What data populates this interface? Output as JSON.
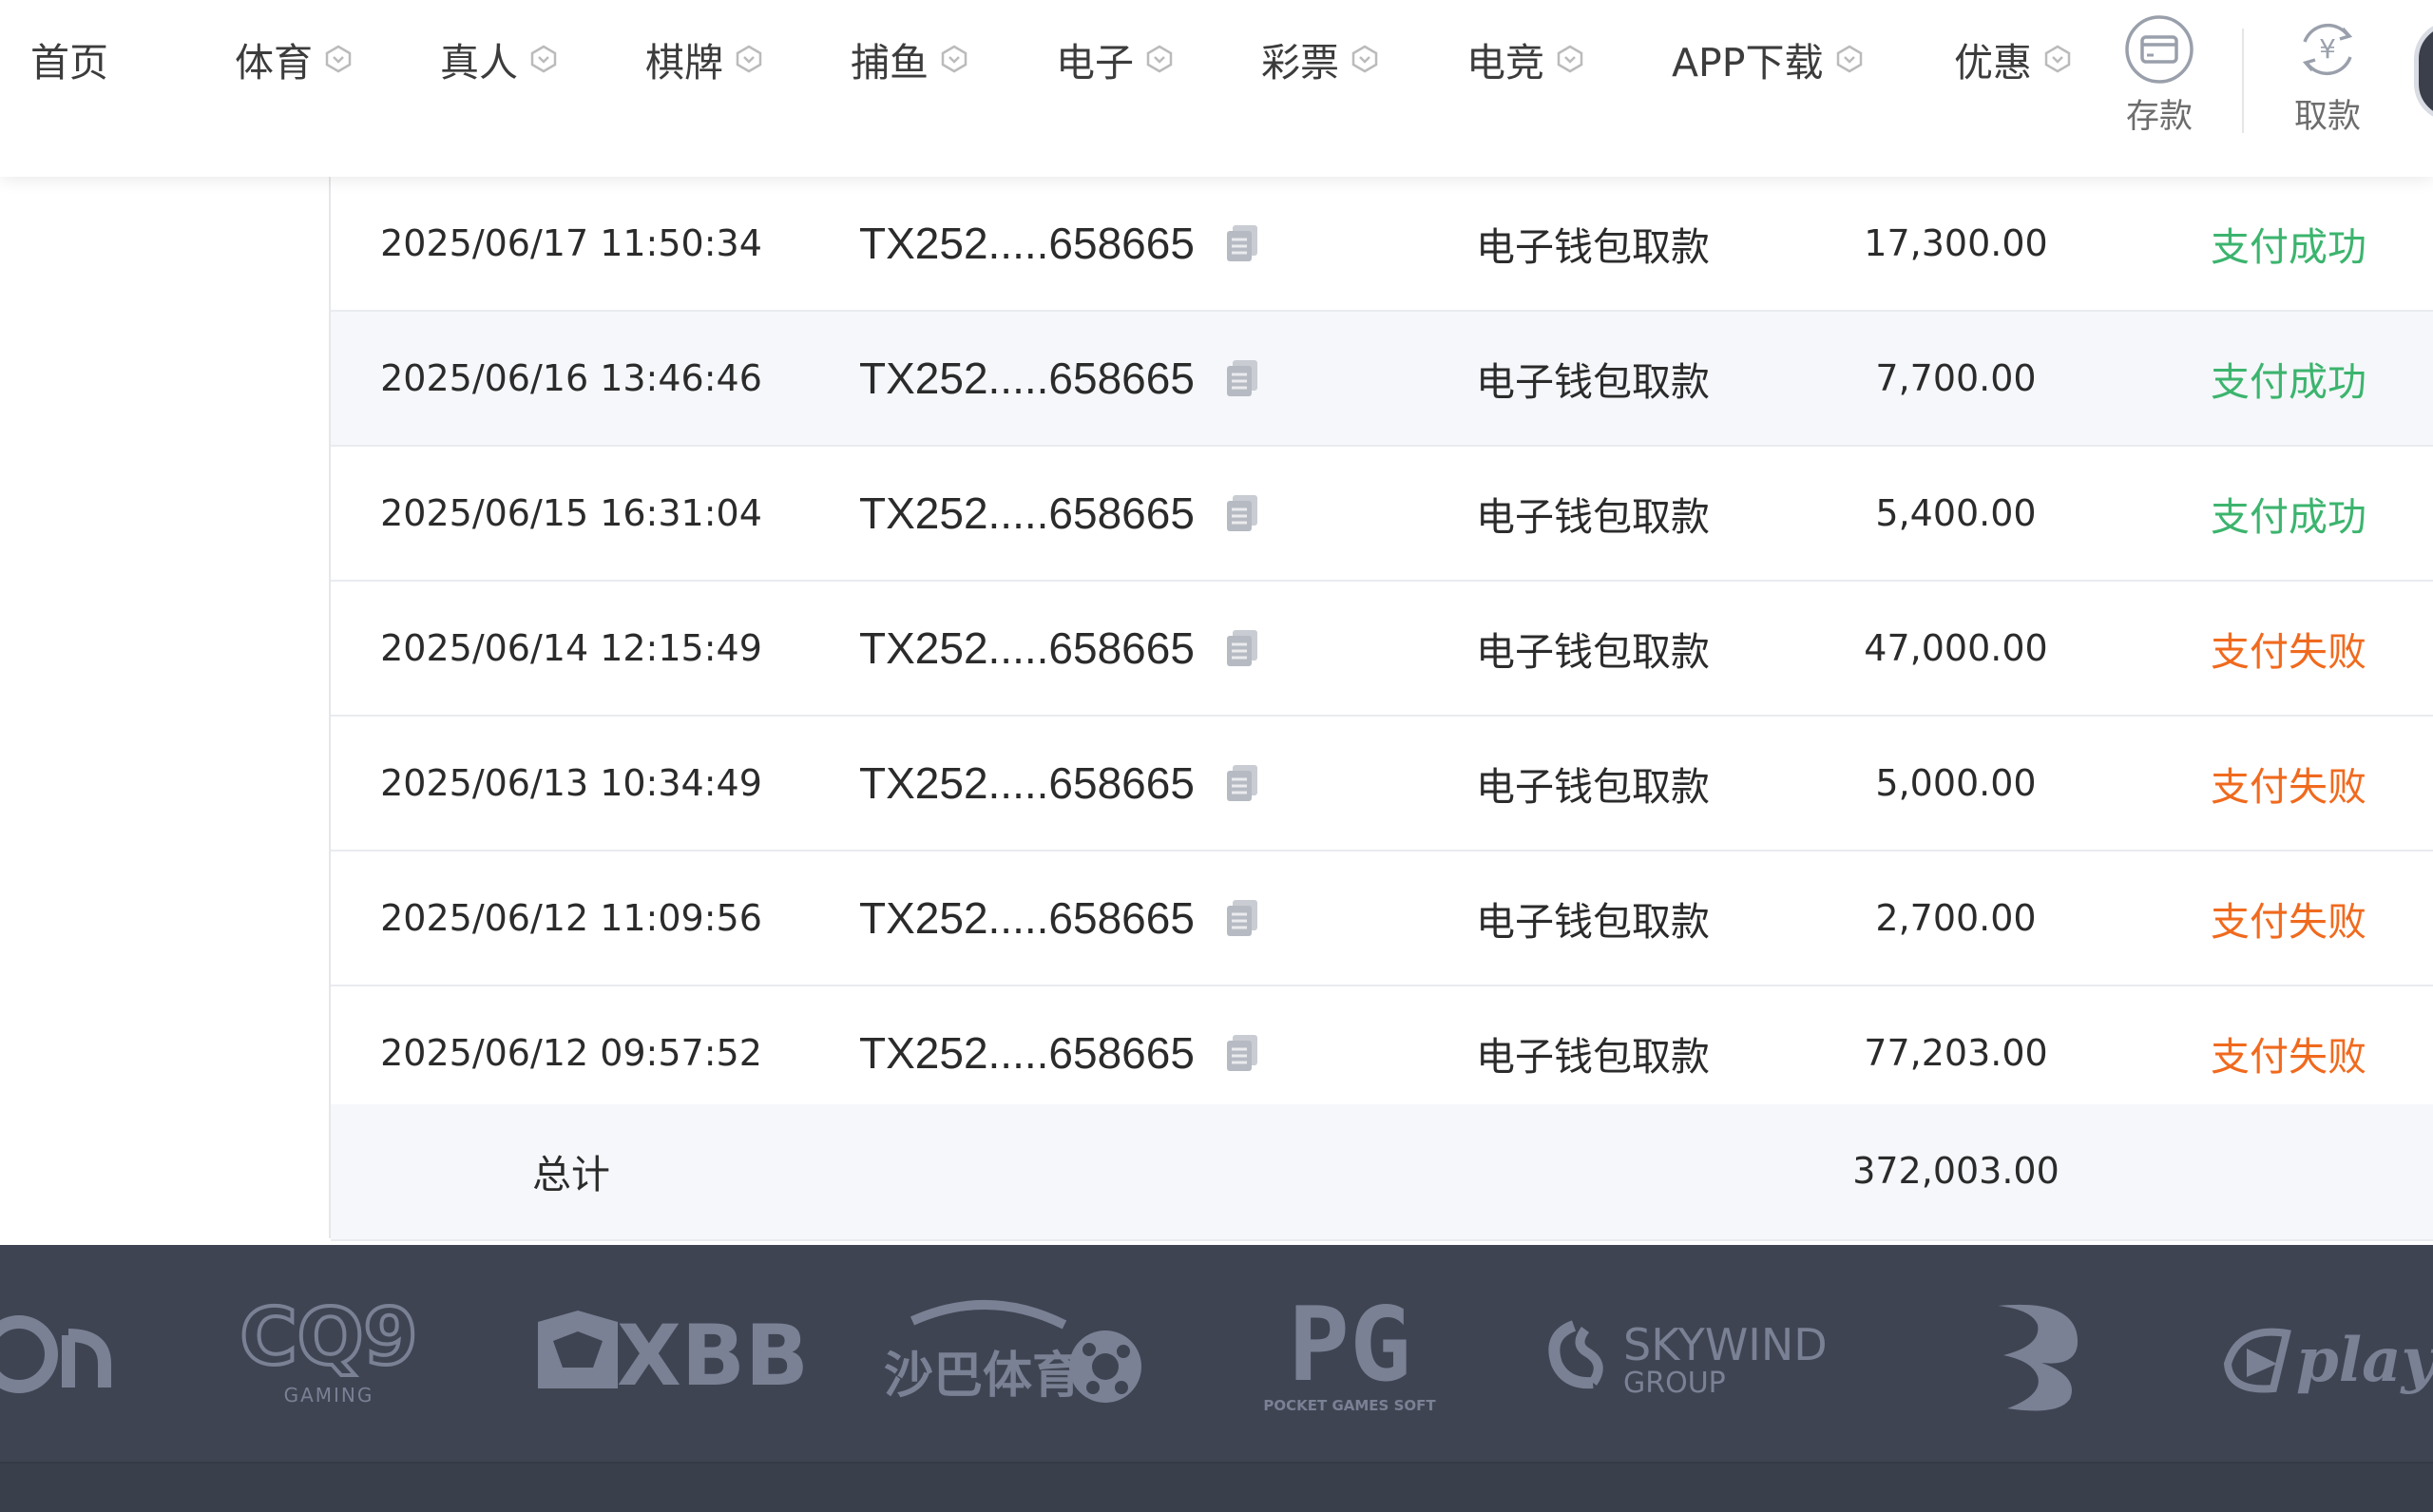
{
  "nav": {
    "home": "首页",
    "items": [
      {
        "label": "体育"
      },
      {
        "label": "真人"
      },
      {
        "label": "棋牌"
      },
      {
        "label": "捕鱼"
      },
      {
        "label": "电子"
      },
      {
        "label": "彩票"
      },
      {
        "label": "电竞"
      },
      {
        "label": "APP下载"
      },
      {
        "label": "优惠"
      }
    ],
    "deposit": "存款",
    "withdraw": "取款"
  },
  "records": [
    {
      "time": "2025/06/17 11:50:34",
      "id": "TX252.....658665",
      "type": "电子钱包取款",
      "amount": "17,300.00",
      "status": "支付成功",
      "status_color": "#3cb46e"
    },
    {
      "time": "2025/06/16 13:46:46",
      "id": "TX252.....658665",
      "type": "电子钱包取款",
      "amount": "7,700.00",
      "status": "支付成功",
      "status_color": "#3cb46e"
    },
    {
      "time": "2025/06/15 16:31:04",
      "id": "TX252.....658665",
      "type": "电子钱包取款",
      "amount": "5,400.00",
      "status": "支付成功",
      "status_color": "#3cb46e"
    },
    {
      "time": "2025/06/14 12:15:49",
      "id": "TX252.....658665",
      "type": "电子钱包取款",
      "amount": "47,000.00",
      "status": "支付失败",
      "status_color": "#f06a1e"
    },
    {
      "time": "2025/06/13 10:34:49",
      "id": "TX252.....658665",
      "type": "电子钱包取款",
      "amount": "5,000.00",
      "status": "支付失败",
      "status_color": "#f06a1e"
    },
    {
      "time": "2025/06/12 11:09:56",
      "id": "TX252.....658665",
      "type": "电子钱包取款",
      "amount": "2,700.00",
      "status": "支付失败",
      "status_color": "#f06a1e"
    },
    {
      "time": "2025/06/12 09:57:52",
      "id": "TX252.....658665",
      "type": "电子钱包取款",
      "amount": "77,203.00",
      "status": "支付失败",
      "status_color": "#f06a1e"
    }
  ],
  "total": {
    "label": "总计",
    "amount": "372,003.00"
  },
  "providers": [
    {
      "name": "CQ9",
      "sub": "GAMING"
    },
    {
      "name": "XBB"
    },
    {
      "name": "沙巴体育"
    },
    {
      "name": "PG",
      "sub": "POCKET GAMES SOFT"
    },
    {
      "name": "SKYWIND",
      "sub": "GROUP"
    },
    {
      "name": "playtech-logo"
    }
  ],
  "colors": {
    "success": "#3cb46e",
    "failure": "#f06a1e",
    "footer_bg": "#3f4452"
  }
}
